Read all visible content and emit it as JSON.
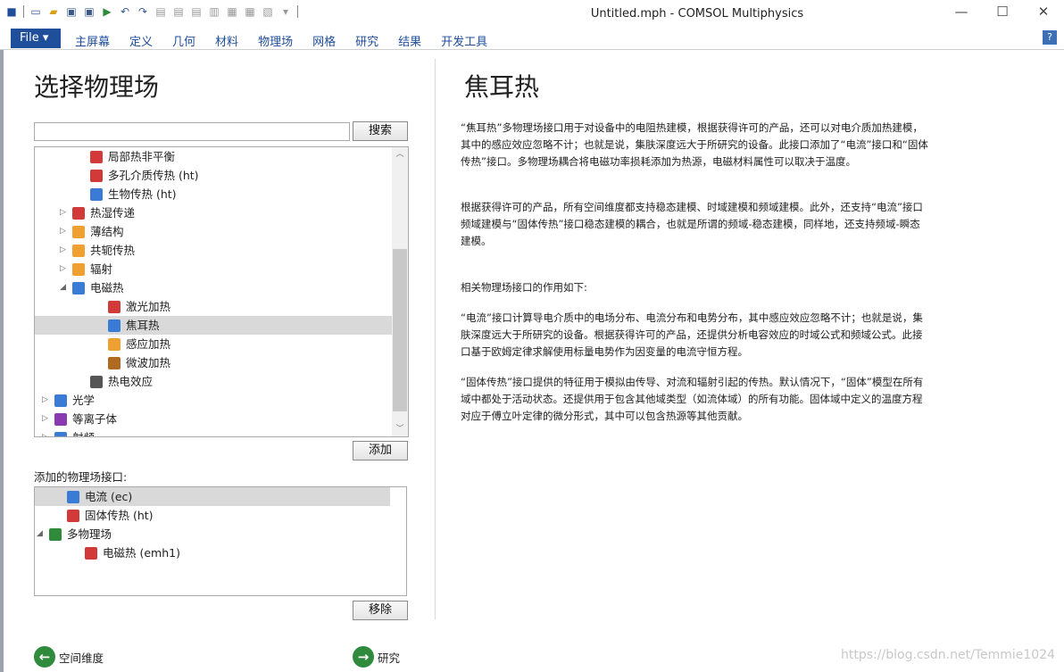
{
  "window": {
    "title": "Untitled.mph - COMSOL Multiphysics",
    "controls": [
      "—",
      "☐",
      "✕"
    ]
  },
  "ribbon": {
    "file_label": "File ▾",
    "tabs": [
      "主屏幕",
      "定义",
      "几何",
      "材料",
      "物理场",
      "网格",
      "研究",
      "结果",
      "开发工具"
    ],
    "help": "?"
  },
  "left": {
    "title": "选择物理场",
    "search_button": "搜索",
    "tree": [
      {
        "label": "局部热非平衡",
        "indent": 2,
        "arrow": "",
        "icon": "heat-icon",
        "color": "#d23a3a"
      },
      {
        "label": "多孔介质传热 (ht)",
        "indent": 2,
        "arrow": "",
        "icon": "heat-icon",
        "color": "#d23a3a"
      },
      {
        "label": "生物传热 (ht)",
        "indent": 2,
        "arrow": "",
        "icon": "bioheat-icon",
        "color": "#3a7bd5"
      },
      {
        "label": "热湿传递",
        "indent": 1,
        "arrow": "▷",
        "icon": "heat-icon",
        "color": "#d23a3a"
      },
      {
        "label": "薄结构",
        "indent": 1,
        "arrow": "▷",
        "icon": "shell-icon",
        "color": "#f0a030"
      },
      {
        "label": "共轭传热",
        "indent": 1,
        "arrow": "▷",
        "icon": "conjugate-icon",
        "color": "#f0a030"
      },
      {
        "label": "辐射",
        "indent": 1,
        "arrow": "▷",
        "icon": "sun-icon",
        "color": "#f0a030"
      },
      {
        "label": "电磁热",
        "indent": 1,
        "arrow": "◢",
        "icon": "em-heat-icon",
        "color": "#3a7bd5"
      },
      {
        "label": "激光加热",
        "indent": 3,
        "arrow": "",
        "icon": "laser-icon",
        "color": "#d23a3a"
      },
      {
        "label": "焦耳热",
        "indent": 3,
        "arrow": "",
        "icon": "joule-icon",
        "color": "#3a7bd5",
        "selected": true
      },
      {
        "label": "感应加热",
        "indent": 3,
        "arrow": "",
        "icon": "induction-icon",
        "color": "#f0a030"
      },
      {
        "label": "微波加热",
        "indent": 3,
        "arrow": "",
        "icon": "microwave-icon",
        "color": "#b06a20"
      },
      {
        "label": "热电效应",
        "indent": 2,
        "arrow": "",
        "icon": "thermoelectric-icon",
        "color": "#555"
      },
      {
        "label": "光学",
        "indent": 0,
        "arrow": "▷",
        "icon": "optics-icon",
        "color": "#3a7bd5"
      },
      {
        "label": "等离子体",
        "indent": 0,
        "arrow": "▷",
        "icon": "plasma-icon",
        "color": "#8a3ab0"
      },
      {
        "label": "射频",
        "indent": 0,
        "arrow": "▷",
        "icon": "rf-icon",
        "color": "#3a7bd5"
      }
    ],
    "add_button": "添加",
    "added_label": "添加的物理场接口:",
    "added": [
      {
        "label": "电流 (ec)",
        "indent": 1,
        "arrow": "",
        "icon": "current-icon",
        "color": "#3a7bd5",
        "selected": true
      },
      {
        "label": "固体传热 (ht)",
        "indent": 1,
        "arrow": "",
        "icon": "heat-solid-icon",
        "color": "#d23a3a"
      },
      {
        "label": "多物理场",
        "indent": 0,
        "arrow": "◢",
        "icon": "multiphysics-icon",
        "color": "#2f8a3c"
      },
      {
        "label": "电磁热 (emh1)",
        "indent": 2,
        "arrow": "",
        "icon": "em-heat-icon",
        "color": "#d23a3a"
      }
    ],
    "remove_button": "移除",
    "back_label": "空间维度",
    "next_label": "研究"
  },
  "right": {
    "title": "焦耳热",
    "paragraphs": [
      "“焦耳热”多物理场接口用于对设备中的电阻热建模，根据获得许可的产品，还可以对电介质加热建模，其中的感应效应忽略不计；也就是说，集肤深度远大于所研究的设备。此接口添加了“电流”接口和“固体传热”接口。多物理场耦合将电磁功率损耗添加为热源，电磁材料属性可以取决于温度。",
      "根据获得许可的产品，所有空间维度都支持稳态建模、时域建模和频域建模。此外，还支持“电流”接口频域建模与“固体传热”接口稳态建模的耦合，也就是所谓的频域-稳态建模，同样地，还支持频域-瞬态建模。",
      "相关物理场接口的作用如下:",
      "“电流”接口计算导电介质中的电场分布、电流分布和电势分布，其中感应效应忽略不计；也就是说，集肤深度远大于所研究的设备。根据获得许可的产品，还提供分析电容效应的时域公式和频域公式。此接口基于欧姆定律求解使用标量电势作为因变量的电流守恒方程。",
      "“固体传热”接口提供的特征用于模拟由传导、对流和辐射引起的传热。默认情况下，“固体”模型在所有域中都处于活动状态。还提供用于包含其他域类型（如流体域）的所有功能。固体域中定义的温度方程对应于傅立叶定律的微分形式，其中可以包含热源等其他贡献。"
    ]
  },
  "watermark": "https://blog.csdn.net/Temmie1024"
}
